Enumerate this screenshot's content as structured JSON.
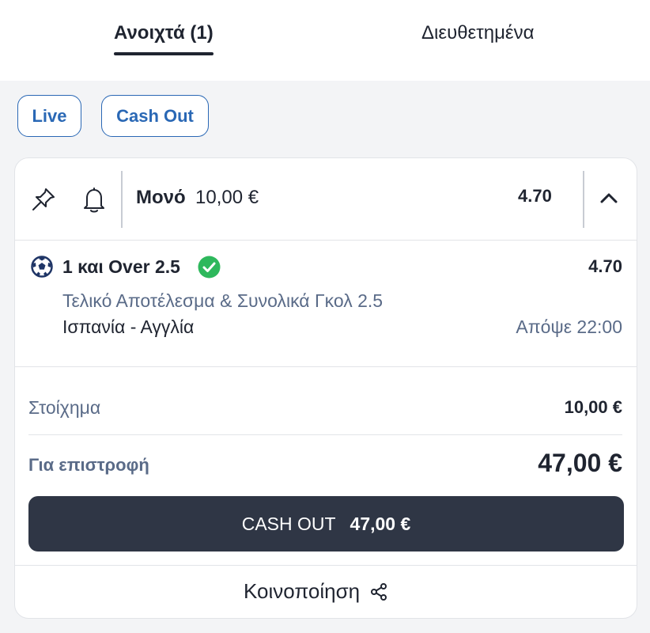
{
  "tabs": {
    "open_label": "Ανοιχτά (1)",
    "settled_label": "Διευθετημένα"
  },
  "filters": {
    "live_label": "Live",
    "cashout_label": "Cash Out"
  },
  "bet": {
    "type": "Μονό",
    "amount": "10,00 €",
    "odds": "4.70",
    "icons": [
      "pin-icon",
      "bell-icon",
      "chevron-up-icon"
    ],
    "selection": {
      "name": "1 και Over 2.5",
      "odds": "4.70",
      "market": "Τελικό Αποτέλεσμα & Συνολικά Γκολ 2.5",
      "event": "Ισπανία - Αγγλία",
      "time": "Απόψε 22:00",
      "icons": [
        "soccer-ball-icon",
        "check-circle-icon"
      ]
    },
    "stake_label": "Στοίχημα",
    "stake_value": "10,00 €",
    "return_label": "Για επιστροφή",
    "return_value": "47,00 €",
    "cashout_label": "CASH OUT",
    "cashout_amount": "47,00 €",
    "share_label": "Κοινοποίηση",
    "share_icon": "share-icon"
  },
  "colors": {
    "accent_blue": "#2a68b5",
    "dark_button": "#2f3645",
    "success_green": "#2eb85c",
    "muted_text": "#5a6b88"
  }
}
